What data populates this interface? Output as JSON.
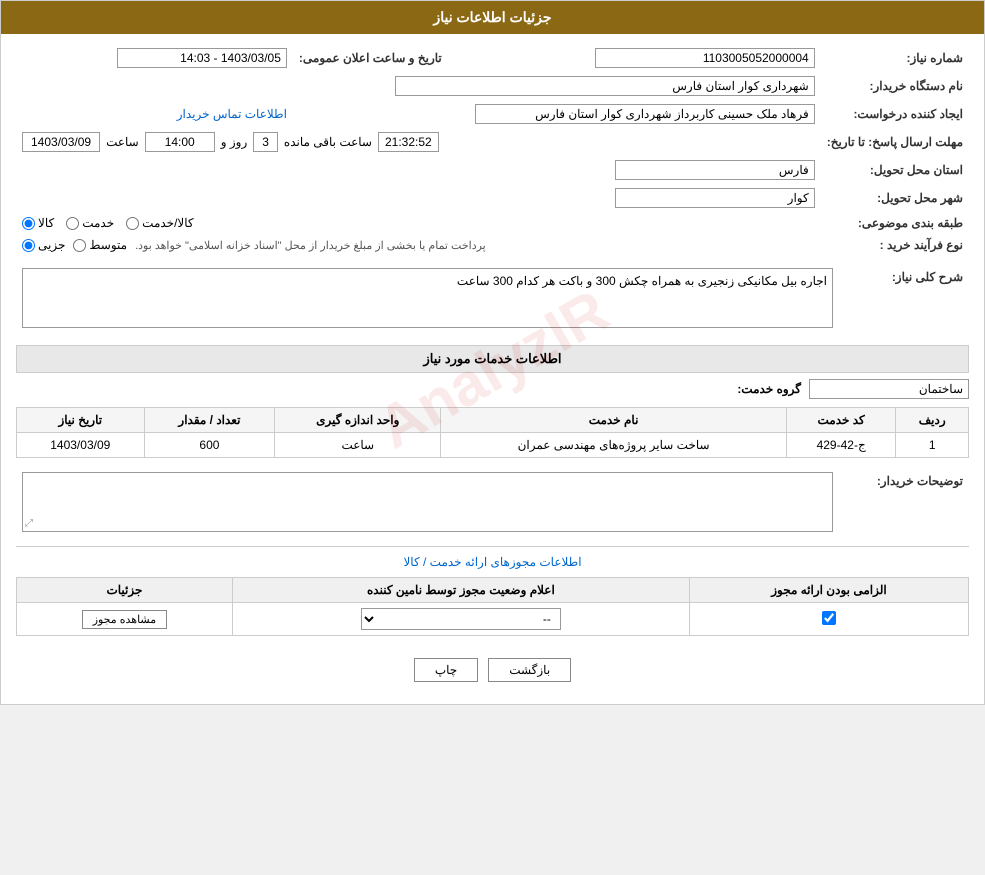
{
  "page": {
    "title": "جزئیات اطلاعات نیاز",
    "header": {
      "label": "جزئیات اطلاعات نیاز"
    }
  },
  "fields": {
    "need_number_label": "شماره نیاز:",
    "need_number_value": "1103005052000004",
    "buyer_org_label": "نام دستگاه خریدار:",
    "buyer_org_value": "شهرداری کوار استان فارس",
    "creator_label": "ایجاد کننده درخواست:",
    "creator_value": "فرهاد ملک حسینی کاربرداز شهرداری کوار استان فارس",
    "creator_link": "اطلاعات تماس خریدار",
    "send_deadline_label": "مهلت ارسال پاسخ: تا تاریخ:",
    "date_value": "1403/03/09",
    "time_label": "ساعت",
    "time_value": "14:00",
    "day_label": "روز و",
    "day_value": "3",
    "remaining_label": "ساعت باقی مانده",
    "remaining_value": "21:32:52",
    "announce_label": "تاریخ و ساعت اعلان عمومی:",
    "announce_value": "1403/03/05 - 14:03",
    "province_label": "استان محل تحویل:",
    "province_value": "فارس",
    "city_label": "شهر محل تحویل:",
    "city_value": "کوار",
    "category_label": "طبقه بندی موضوعی:",
    "category_options": [
      "کالا",
      "خدمت",
      "کالا/خدمت"
    ],
    "category_selected": "کالا",
    "process_label": "نوع فرآیند خرید :",
    "process_options": [
      "جزیی",
      "متوسط"
    ],
    "process_selected": "جزیی",
    "process_description": "پرداخت تمام یا بخشی از مبلغ خریدار از محل \"اسناد خزانه اسلامی\" خواهد بود.",
    "need_description_label": "شرح کلی نیاز:",
    "need_description_value": "اجاره بیل مکانیکی زنجیری به همراه چکش 300 و باکت هر کدام 300 ساعت",
    "services_section_label": "اطلاعات خدمات مورد نیاز",
    "service_group_label": "گروه خدمت:",
    "service_group_value": "ساختمان",
    "table": {
      "headers": [
        "ردیف",
        "کد خدمت",
        "نام خدمت",
        "واحد اندازه گیری",
        "تعداد / مقدار",
        "تاریخ نیاز"
      ],
      "rows": [
        {
          "row": "1",
          "code": "ج-42-429",
          "name": "ساخت سایر پروژه‌های مهندسی عمران",
          "unit": "ساعت",
          "quantity": "600",
          "date": "1403/03/09"
        }
      ]
    },
    "buyer_notes_label": "توضیحات خریدار:",
    "buyer_notes_value": "",
    "permissions_title": "اطلاعات مجوزهای ارائه خدمت / کالا",
    "permissions_table": {
      "headers": [
        "الزامی بودن ارائه مجوز",
        "اعلام وضعیت مجوز توسط نامین کننده",
        "جزئیات"
      ],
      "rows": [
        {
          "required": true,
          "status": "--",
          "details_btn": "مشاهده مجوز"
        }
      ]
    },
    "buttons": {
      "print": "چاپ",
      "back": "بازگشت"
    }
  }
}
